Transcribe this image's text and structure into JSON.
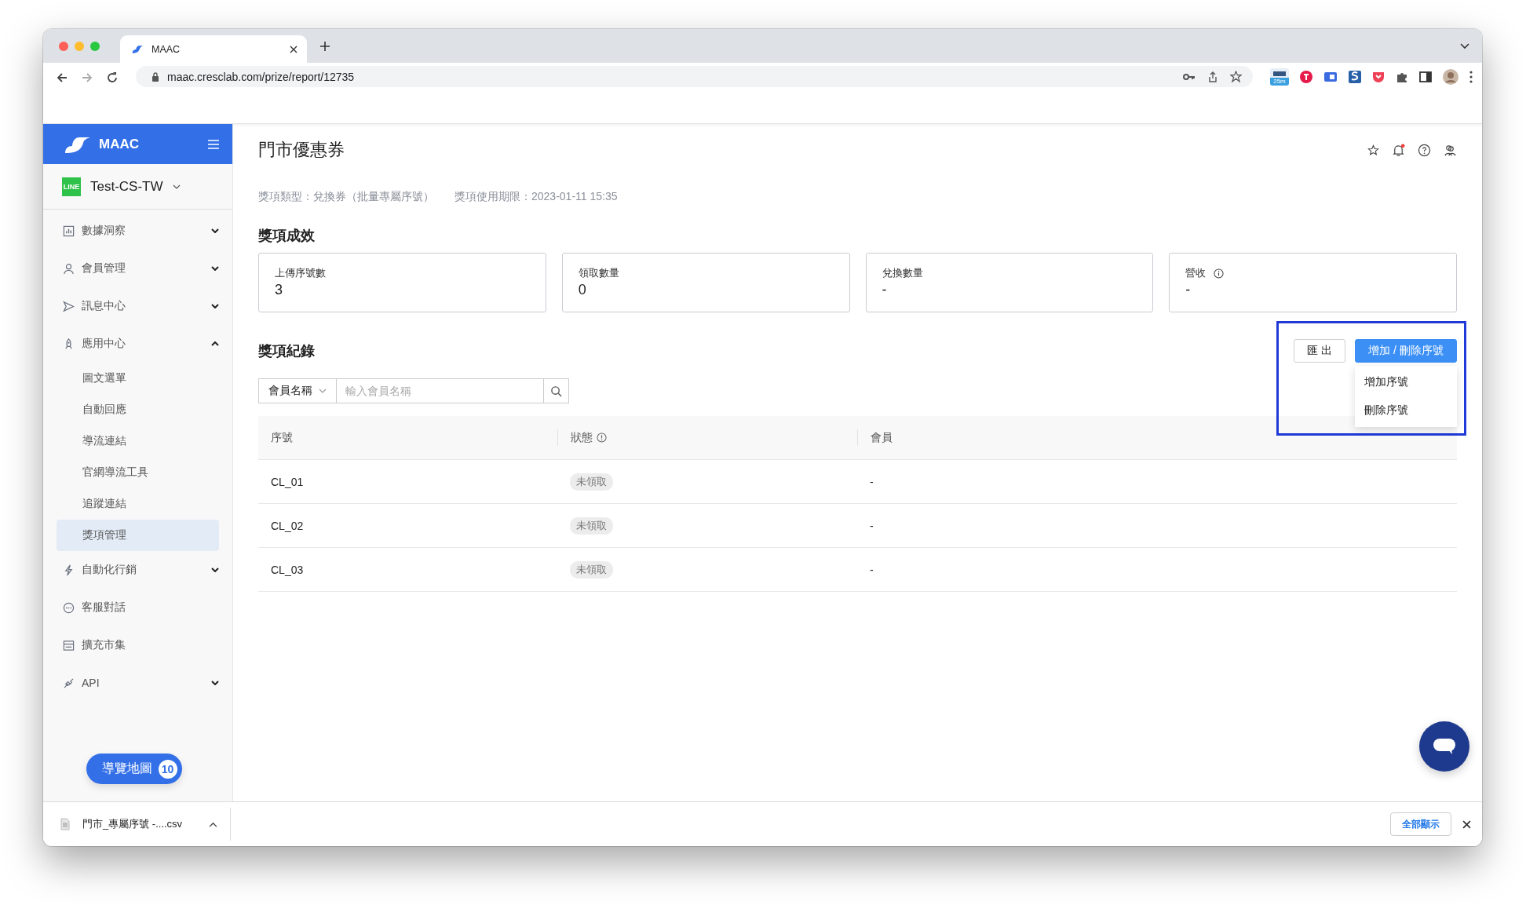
{
  "browser": {
    "tab_title": "MAAC",
    "url": "maac.cresclab.com/prize/report/12735",
    "extension_badge": "25m"
  },
  "sidebar": {
    "brand": "MAAC",
    "account_badge": "LINE",
    "account": "Test-CS-TW",
    "items": [
      {
        "label": "數據洞察",
        "selected": false,
        "expanded": false
      },
      {
        "label": "會員管理",
        "selected": false,
        "expanded": false
      },
      {
        "label": "訊息中心",
        "selected": false,
        "expanded": false
      },
      {
        "label": "應用中心",
        "selected": false,
        "expanded": true,
        "children": [
          {
            "label": "圖文選單",
            "selected": false
          },
          {
            "label": "自動回應",
            "selected": false
          },
          {
            "label": "導流連結",
            "selected": false
          },
          {
            "label": "官網導流工具",
            "selected": false
          },
          {
            "label": "追蹤連結",
            "selected": false
          },
          {
            "label": "獎項管理",
            "selected": true
          }
        ]
      },
      {
        "label": "自動化行銷",
        "selected": false,
        "expanded": false
      },
      {
        "label": "客服對話",
        "selected": false
      },
      {
        "label": "擴充市集",
        "selected": false
      },
      {
        "label": "API",
        "selected": false,
        "expanded": false
      }
    ],
    "guide_button": {
      "label": "導覽地圖",
      "count": "10"
    }
  },
  "header": {
    "title": "門市優惠券",
    "notifications_unread": true
  },
  "meta": [
    "獎項類型：兌換券（批量專屬序號）",
    "獎項使用期限：2023-01-11 15:35"
  ],
  "performance": {
    "heading": "獎項成效",
    "cards": [
      {
        "label": "上傳序號數",
        "value": "3",
        "info": false
      },
      {
        "label": "領取數量",
        "value": "0",
        "info": false
      },
      {
        "label": "兌換數量",
        "value": "-",
        "info": false
      },
      {
        "label": "營收",
        "value": "-",
        "info": true
      }
    ]
  },
  "records": {
    "heading": "獎項紀錄",
    "export_button": "匯 出",
    "edit_button": "增加 / 刪除序號",
    "menu": {
      "open": true,
      "items": [
        "增加序號",
        "刪除序號"
      ]
    },
    "filter": {
      "field": "會員名稱",
      "placeholder": "輸入會員名稱"
    },
    "table": {
      "columns": [
        {
          "label": "序號",
          "info": false
        },
        {
          "label": "狀態",
          "info": true
        },
        {
          "label": "會員",
          "info": false
        }
      ],
      "rows": [
        {
          "serial": "CL_01",
          "status": "未領取",
          "member": "-"
        },
        {
          "serial": "CL_02",
          "status": "未領取",
          "member": "-"
        },
        {
          "serial": "CL_03",
          "status": "未領取",
          "member": "-"
        }
      ]
    }
  },
  "download_bar": {
    "file": "門市_專屬序號 -....csv",
    "show_all": "全部顯示"
  }
}
